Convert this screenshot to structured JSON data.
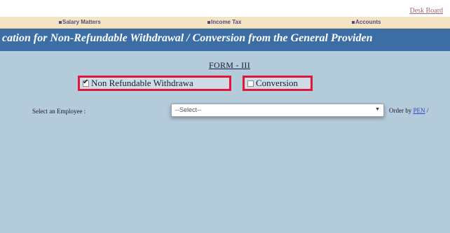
{
  "header": {
    "desk_board": "Desk Board"
  },
  "menu": {
    "items": [
      {
        "label": "Salary Matters"
      },
      {
        "label": "Income Tax"
      },
      {
        "label": "Accounts"
      }
    ]
  },
  "title": "cation for Non-Refundable Withdrawal / Conversion from the General Providen",
  "form": {
    "name": "FORM - III",
    "options": [
      {
        "label": "Non Refundable Withdrawa",
        "checked": true
      },
      {
        "label": "Conversion",
        "checked": false
      }
    ],
    "employee_label": "Select an Employee :",
    "employee_select": "--Select--",
    "order_by_label": "Order by",
    "order_by_link": "PEN",
    "order_by_sep": "/"
  }
}
